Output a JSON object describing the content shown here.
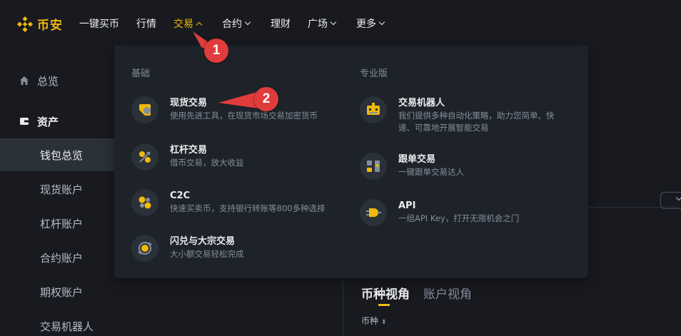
{
  "brand": {
    "name": "币安",
    "accent": "#f0b90b"
  },
  "nav": {
    "items": [
      {
        "label": "一键买币",
        "has_caret": false
      },
      {
        "label": "行情",
        "has_caret": false
      },
      {
        "label": "交易",
        "has_caret": true,
        "active": true
      },
      {
        "label": "合约",
        "has_caret": true
      },
      {
        "label": "理财",
        "has_caret": false
      },
      {
        "label": "广场",
        "has_caret": true
      },
      {
        "label": "更多",
        "has_caret": true
      }
    ]
  },
  "sidebar": {
    "items": [
      {
        "label": "总览",
        "icon": "home-icon"
      },
      {
        "label": "资产",
        "icon": "wallet-icon"
      },
      {
        "label": "钱包总览",
        "selected": true
      },
      {
        "label": "现货账户"
      },
      {
        "label": "杠杆账户"
      },
      {
        "label": "合约账户"
      },
      {
        "label": "期权账户"
      },
      {
        "label": "交易机器人"
      }
    ]
  },
  "dropdown": {
    "basic_title": "基础",
    "pro_title": "专业版",
    "basic_items": [
      {
        "title": "现货交易",
        "desc": "使用先进工具，在现货市场交易加密货币",
        "icon": "spot-trade-icon"
      },
      {
        "title": "杠杆交易",
        "desc": "借币交易，放大收益",
        "icon": "margin-trade-icon"
      },
      {
        "title": "C2C",
        "desc": "快速买卖币，支持银行转账等800多种选择",
        "icon": "c2c-icon"
      },
      {
        "title": "闪兑与大宗交易",
        "desc": "大小额交易轻松完成",
        "icon": "convert-icon"
      }
    ],
    "pro_items": [
      {
        "title": "交易机器人",
        "desc": "我们提供多种自动化策略，助力您简单、快速、可靠地开展智能交易",
        "icon": "robot-icon"
      },
      {
        "title": "跟单交易",
        "desc": "一键跟单交易达人",
        "icon": "copy-trade-icon"
      },
      {
        "title": "API",
        "desc": "一组API Key，打开无限机会之门",
        "icon": "api-plug-icon"
      }
    ]
  },
  "content": {
    "tab_main": "币种视角",
    "tab_sub": "账户视角",
    "col_coin": "币种"
  },
  "markers": {
    "first": "1",
    "second": "2",
    "color": "#e03c3c"
  }
}
